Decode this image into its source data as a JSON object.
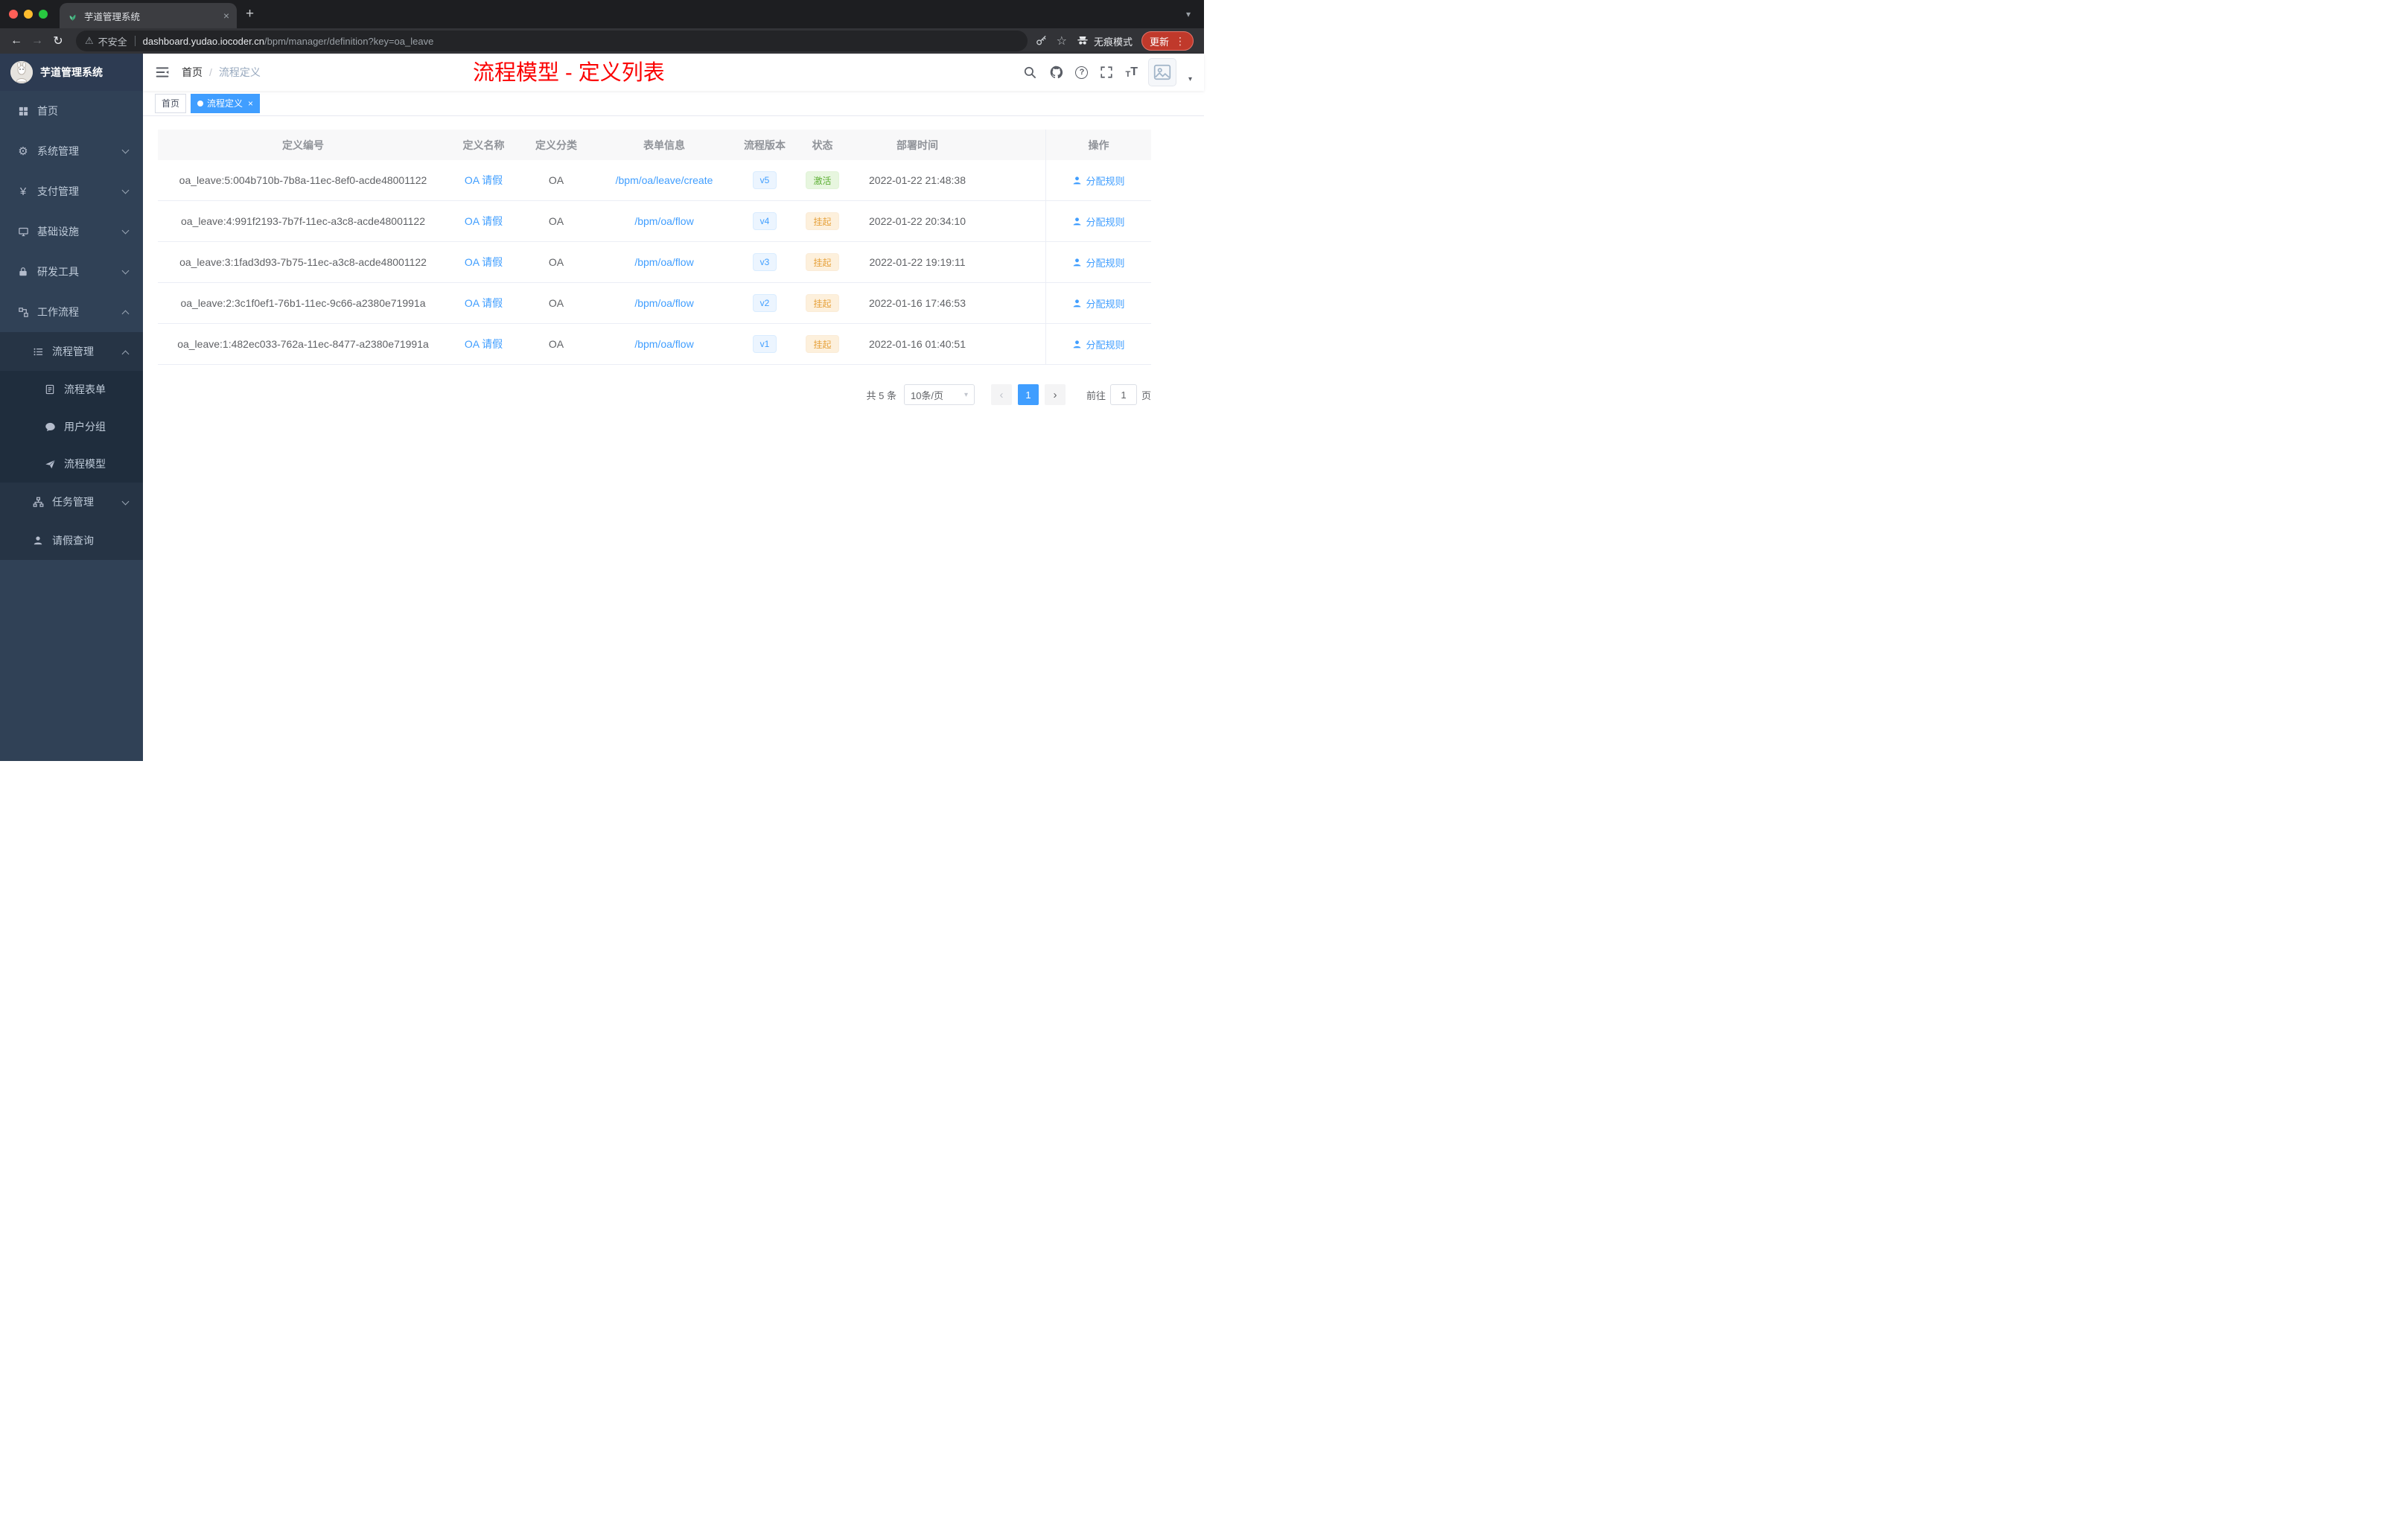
{
  "colors": {
    "accent": "#409eff",
    "success": "#67c23a",
    "warning": "#e6a23c",
    "sidebar_bg": "#304156",
    "annotation_red": "#fb0202"
  },
  "icons": {
    "back": "←",
    "forward": "→",
    "reload": "↻",
    "warning": "⚠",
    "star": "☆",
    "kebab": "⋮",
    "plus": "+",
    "tab_chevron": "▾",
    "close": "×",
    "caret": "▾",
    "gear": "⚙",
    "yen": "¥",
    "help": "?",
    "select_caret": "▾",
    "prev": "‹",
    "next": "›",
    "dot": "",
    "size_small": "T",
    "size_large": "T"
  },
  "browser": {
    "tab_title": "芋道管理系统",
    "security_label": "不安全",
    "url_host": "dashboard.yudao.iocoder.cn",
    "url_path": "/bpm/manager/definition?key=oa_leave",
    "incognito_label": "无痕模式",
    "update_label": "更新"
  },
  "sidebar": {
    "logo_title": "芋道管理系统",
    "items": [
      {
        "label": "首页",
        "icon": "dashboard-icon",
        "level": 1
      },
      {
        "label": "系统管理",
        "icon": "gear-icon",
        "level": 1,
        "chevron": "down"
      },
      {
        "label": "支付管理",
        "icon": "yen-icon",
        "level": 1,
        "chevron": "down"
      },
      {
        "label": "基础设施",
        "icon": "monitor-icon",
        "level": 1,
        "chevron": "down"
      },
      {
        "label": "研发工具",
        "icon": "lock-icon",
        "level": 1,
        "chevron": "down"
      },
      {
        "label": "工作流程",
        "icon": "workflow-icon",
        "level": 1,
        "chevron": "up"
      },
      {
        "label": "流程管理",
        "icon": "list-icon",
        "level": 2,
        "chevron": "up"
      },
      {
        "label": "流程表单",
        "icon": "form-icon",
        "level": 3
      },
      {
        "label": "用户分组",
        "icon": "chat-icon",
        "level": 3
      },
      {
        "label": "流程模型",
        "icon": "paper-plane-icon",
        "level": 3
      },
      {
        "label": "任务管理",
        "icon": "tree-icon",
        "level": 2,
        "chevron": "down"
      },
      {
        "label": "请假查询",
        "icon": "person-icon",
        "level": 2
      }
    ]
  },
  "navbar": {
    "breadcrumb_home": "首页",
    "breadcrumb_sep": "/",
    "breadcrumb_current": "流程定义",
    "annotation": "流程模型 - 定义列表"
  },
  "tags": {
    "home": "首页",
    "active": "流程定义"
  },
  "table": {
    "columns": [
      "定义编号",
      "定义名称",
      "定义分类",
      "表单信息",
      "流程版本",
      "状态",
      "部署时间",
      "操作"
    ],
    "rows": [
      {
        "id": "oa_leave:5:004b710b-7b8a-11ec-8ef0-acde48001122",
        "name": "OA 请假",
        "category": "OA",
        "form": "/bpm/oa/leave/create",
        "version": "v5",
        "status": "激活",
        "status_type": "success",
        "deploy_time": "2022-01-22 21:48:38",
        "action": "分配规则"
      },
      {
        "id": "oa_leave:4:991f2193-7b7f-11ec-a3c8-acde48001122",
        "name": "OA 请假",
        "category": "OA",
        "form": "/bpm/oa/flow",
        "version": "v4",
        "status": "挂起",
        "status_type": "warning",
        "deploy_time": "2022-01-22 20:34:10",
        "action": "分配规则"
      },
      {
        "id": "oa_leave:3:1fad3d93-7b75-11ec-a3c8-acde48001122",
        "name": "OA 请假",
        "category": "OA",
        "form": "/bpm/oa/flow",
        "version": "v3",
        "status": "挂起",
        "status_type": "warning",
        "deploy_time": "2022-01-22 19:19:11",
        "action": "分配规则"
      },
      {
        "id": "oa_leave:2:3c1f0ef1-76b1-11ec-9c66-a2380e71991a",
        "name": "OA 请假",
        "category": "OA",
        "form": "/bpm/oa/flow",
        "version": "v2",
        "status": "挂起",
        "status_type": "warning",
        "deploy_time": "2022-01-16 17:46:53",
        "action": "分配规则"
      },
      {
        "id": "oa_leave:1:482ec033-762a-11ec-8477-a2380e71991a",
        "name": "OA 请假",
        "category": "OA",
        "form": "/bpm/oa/flow",
        "version": "v1",
        "status": "挂起",
        "status_type": "warning",
        "deploy_time": "2022-01-16 01:40:51",
        "action": "分配规则"
      }
    ]
  },
  "pagination": {
    "total": "共 5 条",
    "page_size": "10条/页",
    "current_page": "1",
    "goto_label": "前往",
    "goto_value": "1",
    "page_unit": "页"
  }
}
